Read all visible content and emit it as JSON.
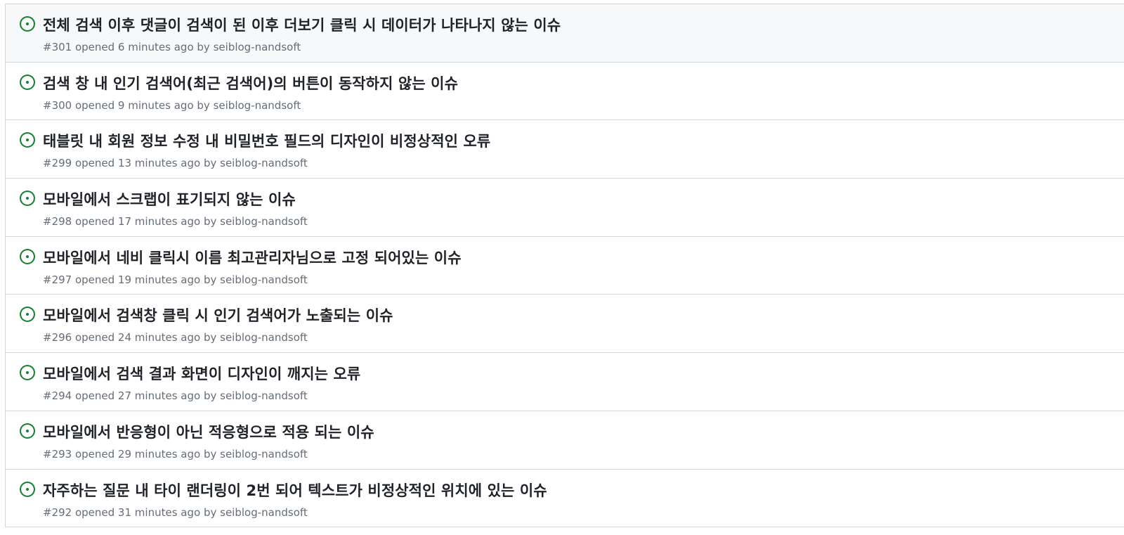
{
  "colors": {
    "open_icon": "#1a7f37",
    "title": "#1f2328",
    "meta": "#656d76",
    "border": "#d0d7de",
    "hover_bg": "#f6f8fa"
  },
  "icons": {
    "issue_state": "issue-opened-icon"
  },
  "issues": [
    {
      "title": "전체 검색 이후 댓글이 검색이 된 이후 더보기 클릭 시 데이터가 나타나지 않는 이슈",
      "number": "#301",
      "opened": "opened 6 minutes ago",
      "by": "by",
      "author": "seiblog-nandsoft"
    },
    {
      "title": "검색 창 내 인기 검색어(최근 검색어)의 버튼이 동작하지 않는 이슈",
      "number": "#300",
      "opened": "opened 9 minutes ago",
      "by": "by",
      "author": "seiblog-nandsoft"
    },
    {
      "title": "태블릿 내 회원 정보 수정 내 비밀번호 필드의 디자인이 비정상적인 오류",
      "number": "#299",
      "opened": "opened 13 minutes ago",
      "by": "by",
      "author": "seiblog-nandsoft"
    },
    {
      "title": "모바일에서 스크랩이 표기되지 않는 이슈",
      "number": "#298",
      "opened": "opened 17 minutes ago",
      "by": "by",
      "author": "seiblog-nandsoft"
    },
    {
      "title": "모바일에서 네비 클릭시 이름 최고관리자님으로 고정 되어있는 이슈",
      "number": "#297",
      "opened": "opened 19 minutes ago",
      "by": "by",
      "author": "seiblog-nandsoft"
    },
    {
      "title": "모바일에서 검색창 클릭 시 인기 검색어가 노출되는 이슈",
      "number": "#296",
      "opened": "opened 24 minutes ago",
      "by": "by",
      "author": "seiblog-nandsoft"
    },
    {
      "title": "모바일에서 검색 결과 화면이 디자인이 깨지는 오류",
      "number": "#294",
      "opened": "opened 27 minutes ago",
      "by": "by",
      "author": "seiblog-nandsoft"
    },
    {
      "title": "모바일에서 반응형이 아닌 적응형으로 적용 되는 이슈",
      "number": "#293",
      "opened": "opened 29 minutes ago",
      "by": "by",
      "author": "seiblog-nandsoft"
    },
    {
      "title": "자주하는 질문 내 타이 랜더링이 2번 되어 텍스트가 비정상적인 위치에 있는 이슈",
      "number": "#292",
      "opened": "opened 31 minutes ago",
      "by": "by",
      "author": "seiblog-nandsoft"
    }
  ]
}
